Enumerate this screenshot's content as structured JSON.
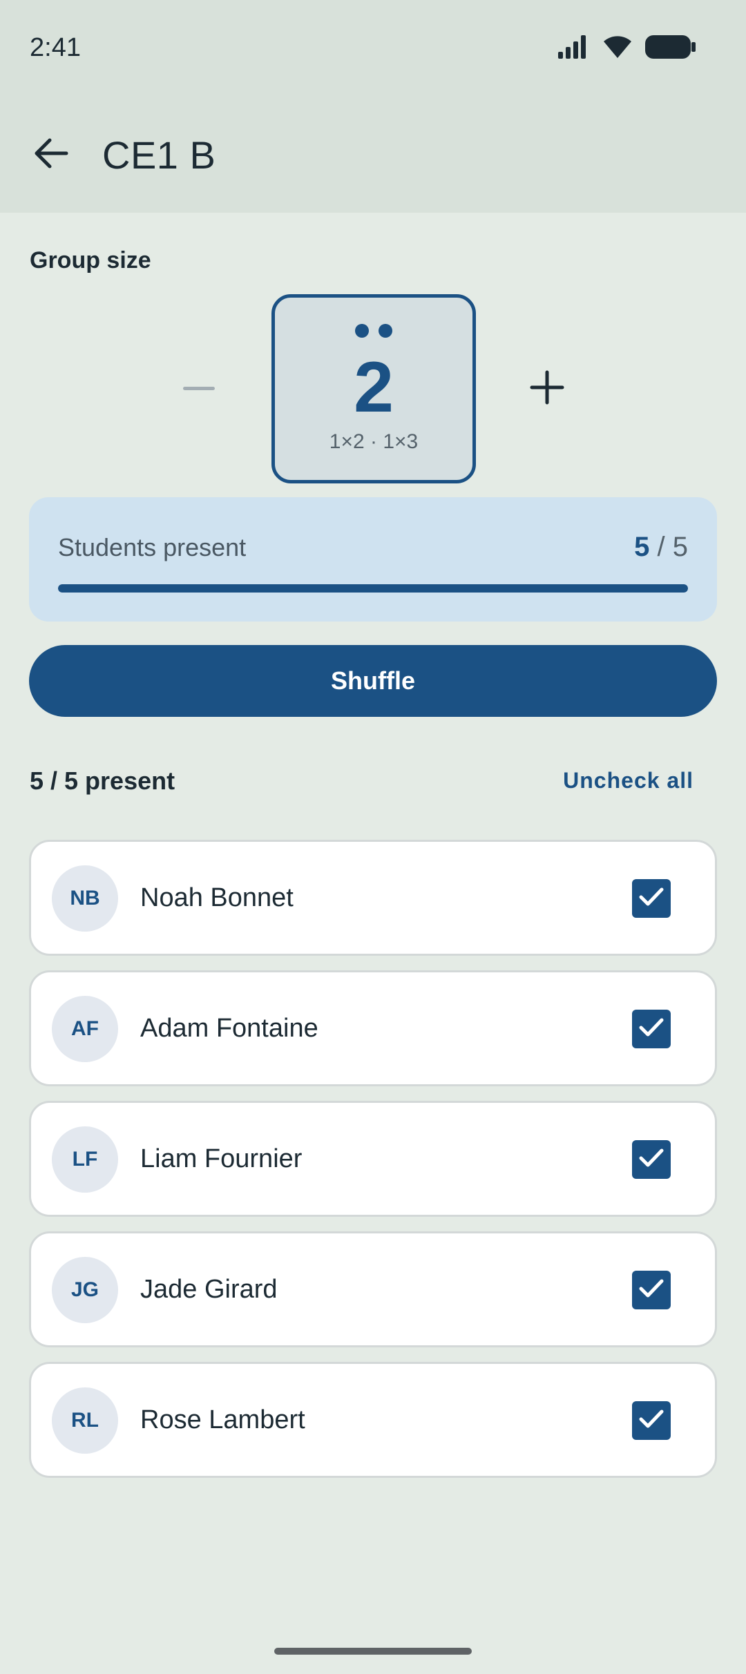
{
  "status_bar": {
    "time": "2:41",
    "icons": [
      "signal-icon",
      "wifi-icon",
      "battery-icon"
    ]
  },
  "header": {
    "back_icon": "arrow-left-icon",
    "title": "CE1 B"
  },
  "group_size": {
    "label": "Group size",
    "value": "2",
    "dots": 2,
    "subtitle": "1×2 · 1×3",
    "decrement_icon": "minus-icon",
    "decrement_enabled": false,
    "increment_icon": "plus-icon"
  },
  "presence": {
    "label": "Students present",
    "present": "5",
    "separator": "/",
    "total": "5",
    "progress_fraction": 1.0
  },
  "shuffle_label": "Shuffle",
  "list_header": {
    "count_text": "5 / 5 present",
    "uncheck_all_label": "Uncheck all"
  },
  "students": [
    {
      "initials": "NB",
      "name": "Noah Bonnet",
      "checked": true
    },
    {
      "initials": "AF",
      "name": "Adam Fontaine",
      "checked": true
    },
    {
      "initials": "LF",
      "name": "Liam Fournier",
      "checked": true
    },
    {
      "initials": "JG",
      "name": "Jade Girard",
      "checked": true
    },
    {
      "initials": "RL",
      "name": "Rose Lambert",
      "checked": true
    }
  ],
  "colors": {
    "accent": "#1b5184",
    "background": "#e4ebe5",
    "topbar": "#d8e1da",
    "presence_card": "#cfe2f0"
  }
}
